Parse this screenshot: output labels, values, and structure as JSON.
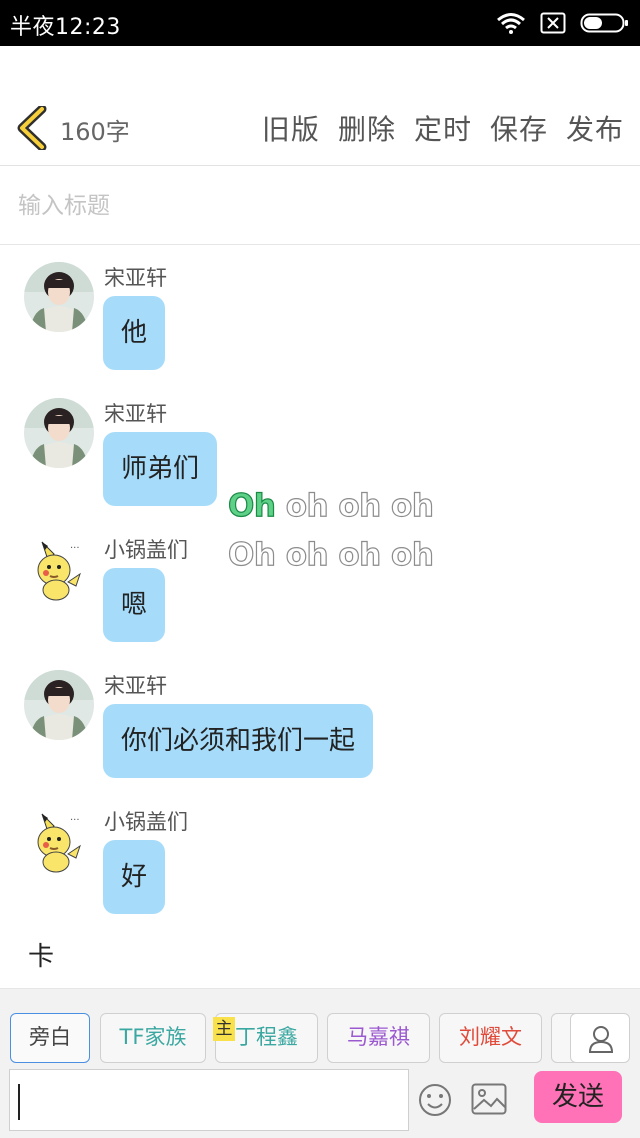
{
  "status_bar": {
    "time": "半夜12:23"
  },
  "toolbar": {
    "char_count": "160字",
    "actions": [
      "旧版",
      "删除",
      "定时",
      "保存",
      "发布"
    ]
  },
  "title_field": {
    "placeholder": "输入标题",
    "value": ""
  },
  "messages": [
    {
      "sender": "宋亚轩",
      "text": "他",
      "avatar": "boy-photo-avatar"
    },
    {
      "sender": "宋亚轩",
      "text": "师弟们",
      "avatar": "boy-photo-avatar"
    },
    {
      "sender": "小锅盖们",
      "text": "嗯",
      "avatar": "pikachu-avatar"
    },
    {
      "sender": "宋亚轩",
      "text": "你们必须和我们一起",
      "avatar": "boy-photo-avatar"
    },
    {
      "sender": "小锅盖们",
      "text": "好",
      "avatar": "pikachu-avatar"
    }
  ],
  "narration": "卡",
  "overlay_text": {
    "line1_highlight": "Oh",
    "line1_rest": " oh oh oh",
    "line2": "Oh oh oh oh"
  },
  "role_tags": [
    "旁白",
    "TF家族",
    "丁程鑫",
    "马嘉祺",
    "刘耀文"
  ],
  "host_badge": "主",
  "composer": {
    "send_label": "发送",
    "value": ""
  },
  "colors": {
    "bubble": "#a6dcfa",
    "send_button": "#ff72b7",
    "tag_tf": "#3aa7a0",
    "tag_ding": "#3aa7a0",
    "tag_ma": "#9b59d0",
    "tag_liu": "#e04a3a",
    "host_badge": "#f8e14a",
    "selected_border": "#4a90e2"
  }
}
